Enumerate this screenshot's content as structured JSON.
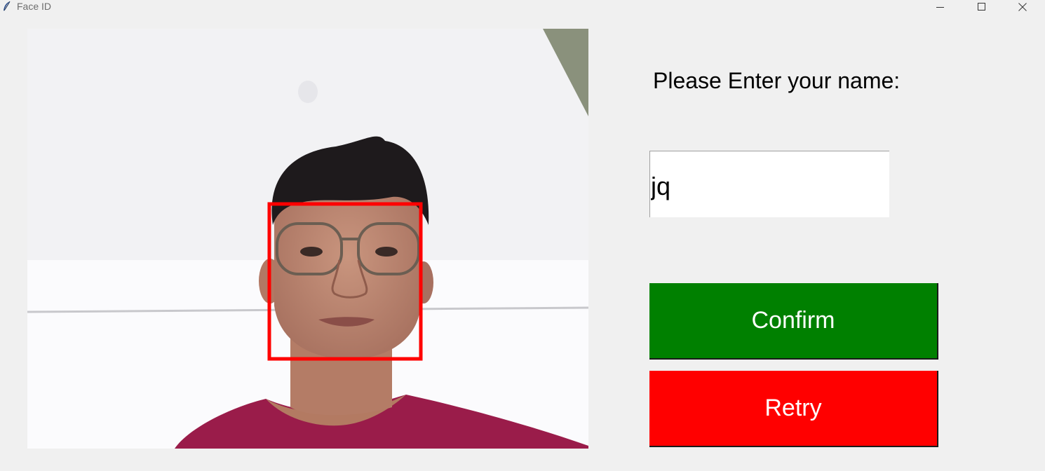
{
  "window": {
    "title": "Face ID",
    "controls": [
      "minimize-icon",
      "maximize-icon",
      "close-icon"
    ]
  },
  "camera": {
    "face_box_color": "#ff0000"
  },
  "form": {
    "prompt": "Please Enter your name:",
    "name_value": "jq",
    "confirm_label": "Confirm",
    "retry_label": "Retry"
  },
  "colors": {
    "confirm_bg": "#008000",
    "retry_bg": "#ff0000",
    "window_bg": "#f0f0f0"
  }
}
